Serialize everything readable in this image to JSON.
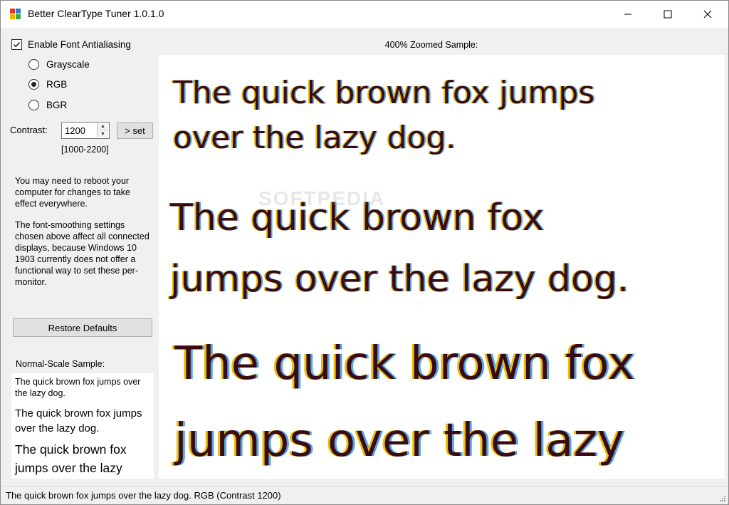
{
  "window": {
    "title": "Better ClearType Tuner 1.0.1.0"
  },
  "titlebar_buttons": {
    "minimize_icon": "minimize-icon",
    "maximize_icon": "maximize-icon",
    "close_icon": "close-icon"
  },
  "settings": {
    "antialiasing_label": "Enable Font Antialiasing",
    "antialiasing_checked": true,
    "radio_options": [
      {
        "label": "Grayscale",
        "selected": false
      },
      {
        "label": "RGB",
        "selected": true
      },
      {
        "label": "BGR",
        "selected": false
      }
    ],
    "contrast_label": "Contrast:",
    "contrast_value": "1200",
    "set_button_label": "> set",
    "contrast_range": "[1000-2200]"
  },
  "info": {
    "reboot_note": "You may need to reboot your computer for changes to take effect everywhere.",
    "smoothing_note": "The font-smoothing settings chosen above affect all connected displays, because Windows 10 1903 currently does not offer a functional way to set these per-monitor."
  },
  "restore_button_label": "Restore Defaults",
  "normal_sample": {
    "title": "Normal-Scale Sample:",
    "lines": [
      "The quick brown fox jumps over the lazy dog.",
      "The quick brown fox jumps over the lazy dog.",
      "The quick brown fox jumps over the lazy"
    ]
  },
  "zoomed_sample": {
    "title": "400% Zoomed Sample:",
    "blocks": [
      [
        "The quick brown fox jumps",
        "over the lazy dog."
      ],
      [
        "The quick brown fox",
        "jumps over the lazy dog."
      ],
      [
        "The quick brown fox",
        "jumps over the lazy"
      ]
    ]
  },
  "watermark": "SOFTPEDIA",
  "status": {
    "text": "The quick brown fox jumps over the lazy dog. RGB (Contrast 1200)"
  },
  "colors": {
    "title_bg": "#ffffff",
    "panel_bg": "#f0f0f0",
    "fringe_left": "#e8c100",
    "fringe_right": "#55a6ea",
    "glyph": "#3a0a14"
  }
}
